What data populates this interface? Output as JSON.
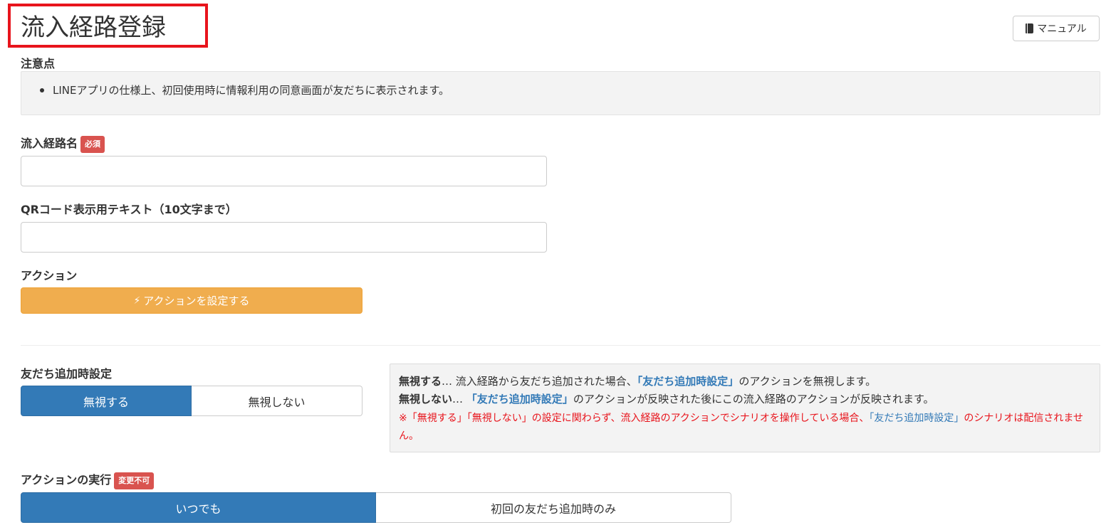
{
  "header": {
    "title": "流入経路登録",
    "manual_label": "マニュアル"
  },
  "notice": {
    "label": "注意点",
    "items": [
      "LINEアプリの仕様上、初回使用時に情報利用の同意画面が友だちに表示されます。"
    ]
  },
  "form": {
    "route_name": {
      "label": "流入経路名",
      "badge": "必須",
      "value": ""
    },
    "qr_text": {
      "label": "QRコード表示用テキスト（10文字まで）",
      "value": ""
    },
    "action": {
      "label": "アクション",
      "button_label": "アクションを設定する"
    }
  },
  "friend_add": {
    "label": "友だち追加時設定",
    "options": [
      "無視する",
      "無視しない"
    ],
    "selected": "無視する",
    "info": {
      "line1_strong": "無視する",
      "line1_ellipsis": "… 流入経路から友だち追加された場合、",
      "line1_link": "「友だち追加時設定」",
      "line1_rest": "のアクションを無視します。",
      "line2_strong": "無視しない",
      "line2_ellipsis": "… ",
      "line2_link": "「友だち追加時設定」",
      "line2_rest": "のアクションが反映された後にこの流入経路のアクションが反映されます。",
      "note_before": "※「無視する」「無視しない」の設定に関わらず、流入経路のアクションでシナリオを操作している場合、",
      "note_link": "「友だち追加時設定」",
      "note_after": "のシナリオは配信されません。"
    }
  },
  "execution": {
    "label": "アクションの実行",
    "badge": "変更不可",
    "options": [
      "いつでも",
      "初回の友だち追加時のみ"
    ],
    "selected": "いつでも"
  },
  "colors": {
    "primary": "#337ab7",
    "warning": "#f0ad4e",
    "danger": "#d9534f",
    "highlight_border": "#e8141c"
  }
}
